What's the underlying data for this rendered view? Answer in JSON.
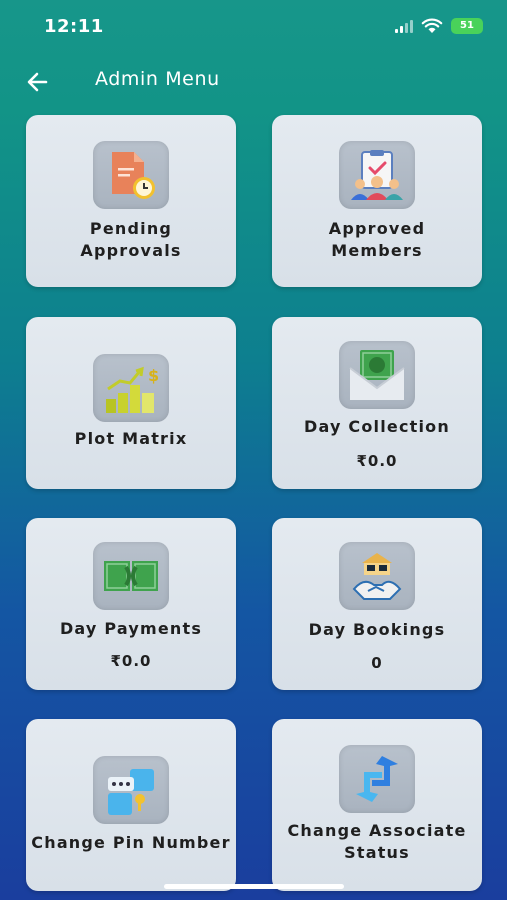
{
  "status_bar": {
    "time": "12:11",
    "battery": "51"
  },
  "app_bar": {
    "title": "Admin Menu"
  },
  "menu": [
    {
      "label_line1": "Pending",
      "label_line2": "Approvals",
      "icon": "pending-approvals-icon"
    },
    {
      "label_line1": "Approved",
      "label_line2": "Members",
      "icon": "approved-members-icon"
    },
    {
      "label": "Plot Matrix",
      "icon": "plot-matrix-icon"
    },
    {
      "label": "Day Collection",
      "value": "₹0.0",
      "icon": "day-collection-icon"
    },
    {
      "label": "Day Payments",
      "value": "₹0.0",
      "icon": "day-payments-icon"
    },
    {
      "label": "Day Bookings",
      "value": "0",
      "icon": "day-bookings-icon"
    },
    {
      "label": "Change Pin Number",
      "icon": "change-pin-icon"
    },
    {
      "label_line1": "Change Associate",
      "label_line2": "Status",
      "icon": "change-associate-status-icon"
    }
  ],
  "colors": {
    "card_bg": "#dde4eb",
    "icon_box_bg": "#b0bac5",
    "gradient_top": "#17968a",
    "gradient_bottom": "#1a3e9e"
  }
}
